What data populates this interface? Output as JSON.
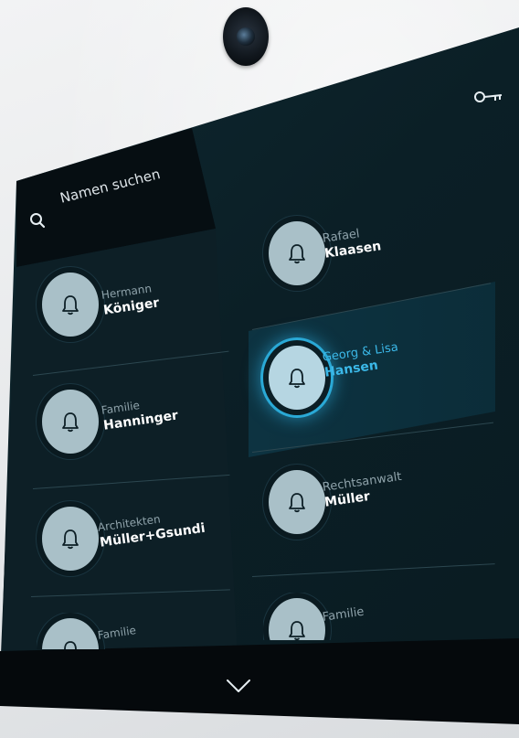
{
  "search": {
    "placeholder": "Namen suchen"
  },
  "icons": {
    "search": "search-icon",
    "key": "key-icon",
    "bell": "bell-icon",
    "scroll_down": "chevron-down-icon"
  },
  "colors": {
    "accent": "#3bb8e8",
    "screen_bg": "#0b1f26",
    "bell_button": "#a9c0c8"
  },
  "left_column": [
    {
      "first": "Hermann",
      "last": "Königer"
    },
    {
      "first": "Familie",
      "last": "Hanninger"
    },
    {
      "first": "Architekten",
      "last": "Müller+Gsundi"
    },
    {
      "first": "Familie",
      "last": ""
    }
  ],
  "right_column": [
    {
      "first": "Rafael",
      "last": "Klaasen",
      "active": false
    },
    {
      "first": "Georg & Lisa",
      "last": "Hansen",
      "active": true
    },
    {
      "first": "Rechtsanwalt",
      "last": "Müller",
      "active": false
    },
    {
      "first": "Familie",
      "last": "",
      "active": false
    }
  ]
}
